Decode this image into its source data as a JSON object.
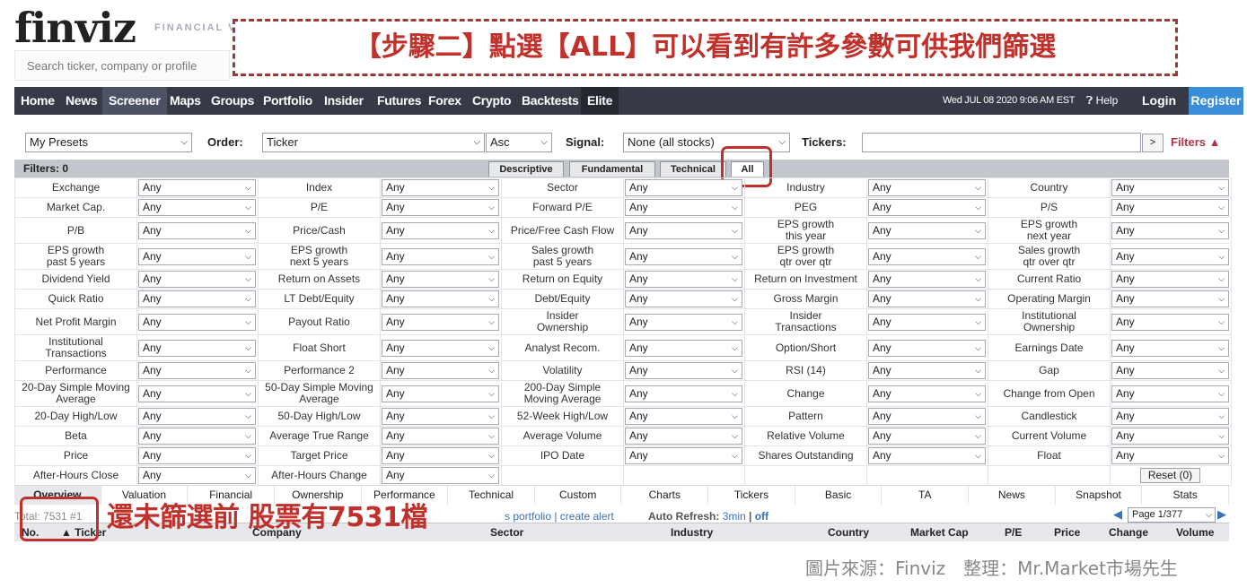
{
  "header": {
    "logo": "finviz",
    "tagline": "FINANCIAL V",
    "search_placeholder": "Search ticker, company or profile",
    "banner_text": "【步驟二】點選【ALL】可以看到有許多參數可供我們篩選"
  },
  "nav": {
    "items": [
      {
        "label": "Home"
      },
      {
        "label": "News"
      },
      {
        "label": "Screener"
      },
      {
        "label": "Maps"
      },
      {
        "label": "Groups"
      },
      {
        "label": "Portfolio"
      },
      {
        "label": "Insider"
      },
      {
        "label": "Futures"
      },
      {
        "label": "Forex"
      },
      {
        "label": "Crypto"
      },
      {
        "label": "Backtests"
      },
      {
        "label": "Elite"
      }
    ],
    "active": "Screener",
    "datetime": "Wed JUL 08 2020 9:06 AM EST",
    "help": "Help",
    "login": "Login",
    "register": "Register"
  },
  "controls": {
    "presets_value": "My Presets",
    "order_label": "Order:",
    "order_value": "Ticker",
    "direction_value": "Asc",
    "signal_label": "Signal:",
    "signal_value": "None (all stocks)",
    "tickers_label": "Tickers:",
    "tickers_value": "",
    "go_label": ">",
    "filters_toggle": "Filters ▲"
  },
  "filter_bar": {
    "count_label": "Filters: 0",
    "tabs": [
      {
        "label": "Descriptive"
      },
      {
        "label": "Fundamental"
      },
      {
        "label": "Technical"
      },
      {
        "label": "All"
      }
    ],
    "active_tab": "All"
  },
  "filters": {
    "default_value": "Any",
    "rows": [
      [
        "Exchange",
        "Index",
        "Sector",
        "Industry",
        "Country"
      ],
      [
        "Market Cap.",
        "P/E",
        "Forward P/E",
        "PEG",
        "P/S"
      ],
      [
        "P/B",
        "Price/Cash",
        "Price/Free Cash Flow",
        "EPS growth\nthis year",
        "EPS growth\nnext year"
      ],
      [
        "EPS growth\npast 5 years",
        "EPS growth\nnext 5 years",
        "Sales growth\npast 5 years",
        "EPS growth\nqtr over qtr",
        "Sales growth\nqtr over qtr"
      ],
      [
        "Dividend Yield",
        "Return on Assets",
        "Return on Equity",
        "Return on Investment",
        "Current Ratio"
      ],
      [
        "Quick Ratio",
        "LT Debt/Equity",
        "Debt/Equity",
        "Gross Margin",
        "Operating Margin"
      ],
      [
        "Net Profit Margin",
        "Payout Ratio",
        "Insider\nOwnership",
        "Insider\nTransactions",
        "Institutional\nOwnership"
      ],
      [
        "Institutional\nTransactions",
        "Float Short",
        "Analyst Recom.",
        "Option/Short",
        "Earnings Date"
      ],
      [
        "Performance",
        "Performance 2",
        "Volatility",
        "RSI (14)",
        "Gap"
      ],
      [
        "20-Day Simple Moving\nAverage",
        "50-Day Simple Moving\nAverage",
        "200-Day Simple\nMoving Average",
        "Change",
        "Change from Open"
      ],
      [
        "20-Day High/Low",
        "50-Day High/Low",
        "52-Week High/Low",
        "Pattern",
        "Candlestick"
      ],
      [
        "Beta",
        "Average True Range",
        "Average Volume",
        "Relative Volume",
        "Current Volume"
      ],
      [
        "Price",
        "Target Price",
        "IPO Date",
        "Shares Outstanding",
        "Float"
      ],
      [
        "After-Hours Close",
        "After-Hours Change",
        "",
        "",
        ""
      ]
    ],
    "reset_label": "Reset (0)"
  },
  "view_tabs": [
    "Overview",
    "Valuation",
    "Financial",
    "Ownership",
    "Performance",
    "Technical",
    "Custom",
    "Charts",
    "Tickers",
    "Basic",
    "TA",
    "News",
    "Snapshot",
    "Stats"
  ],
  "info": {
    "total": "Total: 7531 #1",
    "links": "s portfolio | create alert",
    "auto_refresh_label": "Auto Refresh:",
    "refresh_3min": "3min",
    "refresh_sep": "|",
    "refresh_off": "off",
    "page_select": "Page 1/377",
    "overlay_text": "還未篩選前 股票有7531檔"
  },
  "results_header": {
    "columns": [
      "No.",
      "▲ Ticker",
      "Company",
      "Sector",
      "Industry",
      "Country",
      "Market Cap",
      "P/E",
      "Price",
      "Change",
      "Volume"
    ]
  },
  "credit": "圖片來源：Finviz　整理：Mr.Market市場先生",
  "colors": {
    "nav_bg": "#363a46",
    "register_bg": "#3a8dd7",
    "annotation_red": "#c0312b",
    "link_blue": "#3a72b8"
  }
}
